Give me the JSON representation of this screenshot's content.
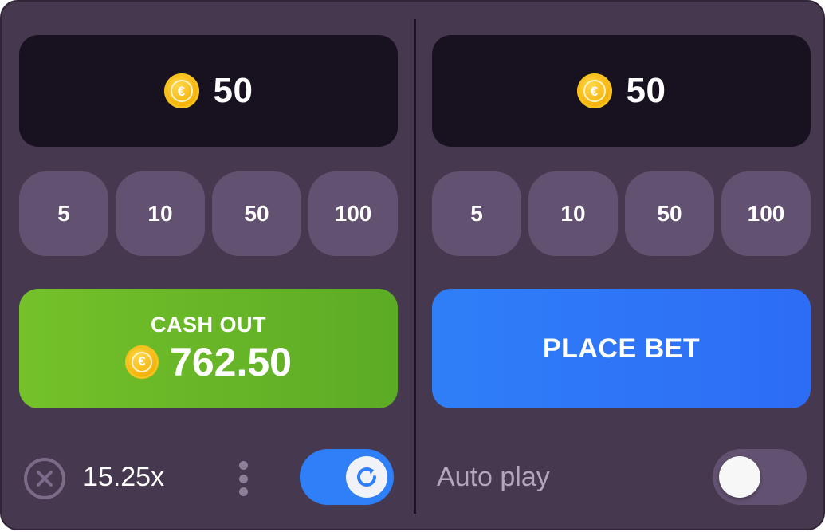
{
  "left_panel": {
    "bet_amount": "50",
    "quick_bets": [
      "5",
      "10",
      "50",
      "100"
    ],
    "cashout": {
      "label": "CASH OUT",
      "value": "762.50"
    },
    "multiplier": "15.25x",
    "auto_cashout_enabled": true
  },
  "right_panel": {
    "bet_amount": "50",
    "quick_bets": [
      "5",
      "10",
      "50",
      "100"
    ],
    "place_bet_label": "PLACE BET",
    "auto_play_label": "Auto play",
    "auto_play_enabled": false
  },
  "icons": {
    "coin": "euro-coin-icon",
    "cancel": "cancel-circle-icon",
    "menu": "vertical-dots-icon",
    "refresh": "refresh-icon"
  },
  "colors": {
    "panel_bg": "#46384f",
    "display_bg": "#18111f",
    "chip_bg": "#625170",
    "cashout_green": "#5cab25",
    "placebet_blue": "#2d6cf5",
    "toggle_on": "#2f7ff8",
    "coin_gold": "#f6b40e"
  }
}
